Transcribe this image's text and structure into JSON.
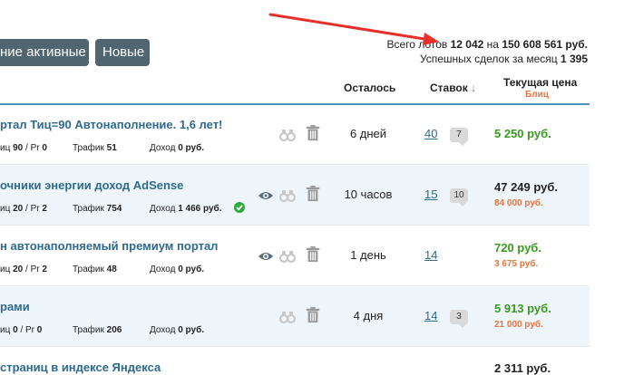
{
  "buttons": {
    "active_label": "ние активные",
    "new_label": "Новые"
  },
  "stats": {
    "total_prefix": "Всего лотов",
    "total_lots": "12 042",
    "total_mid": "на",
    "total_sum": "150 608 561 руб.",
    "month_prefix": "Успешных сделок за месяц",
    "month_deals": "1 395"
  },
  "headers": {
    "remaining": "Осталось",
    "bids": "Ставок",
    "sort_arrow": "↓",
    "price": "Текущая цена",
    "blitz": "Блиц"
  },
  "labels": {
    "tic": "иц",
    "pr": "Pr",
    "traffic": "Трафик",
    "income": "Доход",
    "rub": "руб."
  },
  "lots": [
    {
      "title": "ртал Тиц=90 Автонаполнение. 1,6 лет!",
      "tic": "90",
      "pr": "0",
      "traffic": "51",
      "income": "0",
      "remaining": "6 дней",
      "bids": "40",
      "comments": "7",
      "price": "5 250 руб.",
      "blitz": ""
    },
    {
      "title": "очники энергии доход AdSense",
      "tic": "20",
      "pr": "2",
      "traffic": "754",
      "income": "1 466",
      "remaining": "10 часов",
      "bids": "15",
      "comments": "10",
      "price": "47 249 руб.",
      "blitz": "84 000 руб."
    },
    {
      "title": "н автонаполняемый премиум портал",
      "tic": "20",
      "pr": "2",
      "traffic": "48",
      "income": "0",
      "remaining": "1 день",
      "bids": "14",
      "comments": "",
      "price": "720 руб.",
      "blitz": "3 675 руб."
    },
    {
      "title": "рами",
      "tic": "0",
      "pr": "0",
      "traffic": "206",
      "income": "0",
      "remaining": "4 дня",
      "bids": "14",
      "comments": "3",
      "price": "5 913 руб.",
      "blitz": "21 000 руб."
    },
    {
      "title": "страниц в индексе Яндекса",
      "tic": "",
      "pr": "",
      "traffic": "",
      "income": "",
      "remaining": "",
      "bids": "",
      "comments": "",
      "price": "2 311 руб.",
      "blitz": ""
    }
  ],
  "colors": {
    "arrow": "#e8302a",
    "header_line": "#4a90c2",
    "price_green": "#3a9a1f",
    "price_dark": "#222222",
    "blitz": "#e8743b",
    "check": "#2eaa3a"
  }
}
